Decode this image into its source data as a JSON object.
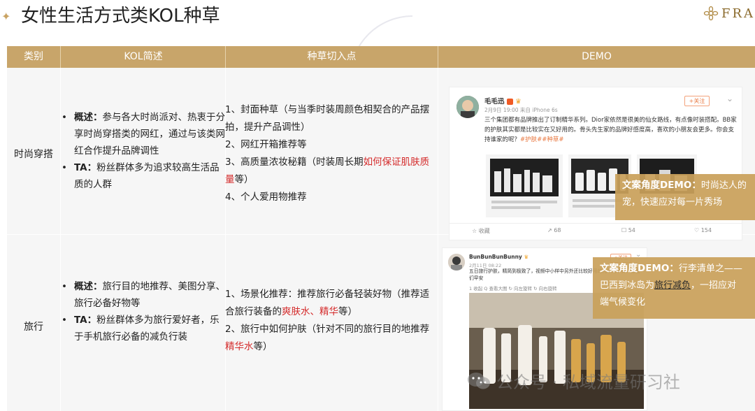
{
  "header": {
    "title": "女性生活方式类KOL种草",
    "logo_text": "FRA"
  },
  "table": {
    "columns": [
      "类别",
      "KOL简述",
      "种草切入点",
      "DEMO"
    ],
    "rows": [
      {
        "category": "时尚穿搭",
        "overview_label": "概述：",
        "overview_text": "参与各大时尚派对、热衷于分享时尚穿搭类的网红，通过与该类网红合作提升品牌调性",
        "ta_label": "TA：",
        "ta_text": "粉丝群体多为追求较高生活品质的人群",
        "entry_points": [
          {
            "pre": "1、封面种草（与当季时装周颜色相契合的产品摆拍，提升产品调性）"
          },
          {
            "pre": "2、网红开箱推荐等"
          },
          {
            "pre": "3、高质量浓妆秘籍（时装周长期",
            "red": "如何保证肌肤质量",
            "post": "等）"
          },
          {
            "pre": "4、个人爱用物推荐"
          }
        ],
        "demo": {
          "nickname": "毛毛迅",
          "meta": "2月9日 19:00 来自 iPhone 6s",
          "follow": "+关注",
          "post": "三个集团都有品牌推出了订制精华系列。Dior家依然是很美的仙女路线，有点像时装搭配。BB家的护肤其实都是比较实在又好用的。骨头先生家的品牌好感度高，喜欢的小朋友会更多。你会支持谁家的呢？",
          "tags": "#护肤##种草#",
          "stats": [
            "☆ 收藏",
            "↗ 68",
            "☐ 54",
            "♡ 154"
          ],
          "overlay_title": "文案角度DEMO：",
          "overlay_line1": "时尚达人的",
          "overlay_line2": "宠，快速应对每一片秀场"
        }
      },
      {
        "category": "旅行",
        "overview_label": "概述：",
        "overview_text": "旅行目的地推荐、美图分享、旅行必备好物等",
        "ta_label": "TA：",
        "ta_text": "粉丝群体多为旅行爱好者，乐于手机旅行必备的减负行装",
        "entry_points": [
          {
            "pre": "1、场景化推荐：推荐旅行必备轻装好物（推荐适合旅行装备的",
            "red": "爽肤水、精华",
            "post": "等）"
          },
          {
            "pre": "2、旅行中如何护肤（针对不同的旅行目的地推荐",
            "red": "精华水",
            "post": "等）"
          }
        ],
        "demo": {
          "nickname": "BunBunBunBunny",
          "meta": "2月11日 08:22",
          "follow": "+关注",
          "post": "五日旅行护肤，精简到极致了，视频中小样中另外还比较好用的几个的节奏，宝宝们早安",
          "actions": "1 收起  Q 查看大图  ↻ 向左旋转  ↻ 向右旋转",
          "overlay_title": "文案角度DEMO：",
          "overlay_line1_tail": "行李清单之——",
          "overlay_line2_pre": "巴西到冰岛为",
          "overlay_line2_hl": "旅行减负",
          "overlay_line2_post": "，一招应对",
          "overlay_line3": "端气候变化"
        }
      }
    ]
  },
  "watermark": "公众号 · 私域流量研习社",
  "colors": {
    "accent": "#c8a56a",
    "highlight_red": "#d42a2a",
    "overlay": "#c9a05a"
  }
}
